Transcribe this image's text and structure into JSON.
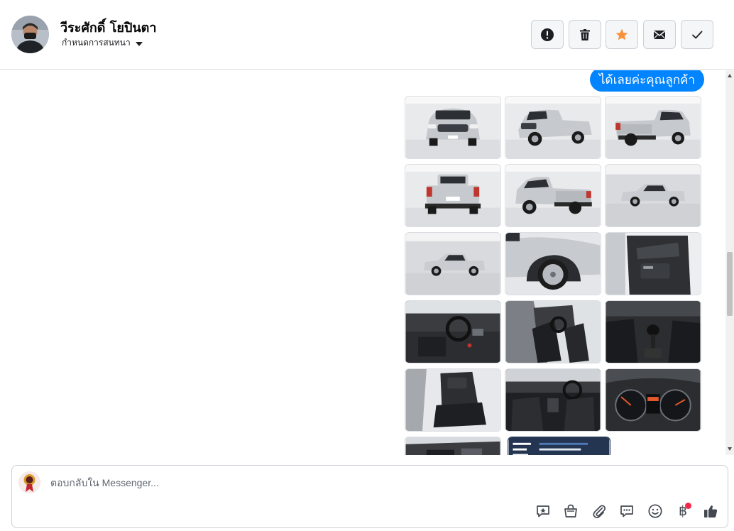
{
  "header": {
    "contact_name": "วีระศักดิ์ โยปินตา",
    "assign_label": "กำหนดการสนทนา",
    "actions": [
      {
        "name": "mark-spam-button",
        "icon": "exclamation-icon"
      },
      {
        "name": "delete-button",
        "icon": "trash-icon"
      },
      {
        "name": "star-button",
        "icon": "star-icon"
      },
      {
        "name": "mark-unread-button",
        "icon": "envelope-icon"
      },
      {
        "name": "mark-done-button",
        "icon": "checkmark-icon"
      }
    ]
  },
  "thread": {
    "last_message": "ได้เลยค่ะคุณลูกค้า",
    "photos": [
      "front-view",
      "front-three-quarter",
      "rear-three-quarter",
      "rear-view",
      "rear-left-three-quarter",
      "side-view",
      "side-view-wide",
      "wheel-closeup",
      "door-panel",
      "dashboard",
      "front-seats",
      "gear-shifter",
      "rear-seats",
      "interior-overview",
      "instrument-cluster",
      "engine-bay",
      "spec-sheet"
    ]
  },
  "composer": {
    "placeholder": "ตอบกลับใน Messenger...",
    "tools": [
      "saved-replies-icon",
      "shop-icon",
      "attachment-icon",
      "chat-icon",
      "emoji-icon",
      "baht-icon",
      "thumbs-up-icon"
    ],
    "baht_symbol": "฿"
  },
  "colors": {
    "accent": "#0084ff",
    "star": "#f7923a",
    "notification_dot": "#f0284a"
  }
}
